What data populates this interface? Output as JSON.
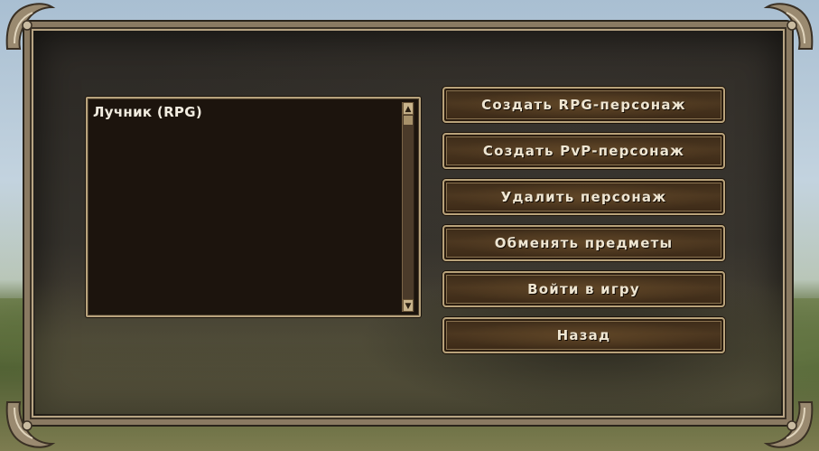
{
  "character_list": {
    "items": [
      {
        "label": "Лучник (RPG)"
      }
    ]
  },
  "menu": {
    "create_rpg_label": "Создать RPG-персонаж",
    "create_pvp_label": "Создать PvP-персонаж",
    "delete_label": "Удалить персонаж",
    "exchange_label": "Обменять предметы",
    "enter_game_label": "Войти в игру",
    "back_label": "Назад"
  },
  "icons": {
    "scroll_up": "arrow-up-icon",
    "scroll_down": "arrow-down-icon",
    "corner": "ornament-corner-icon"
  },
  "colors": {
    "panel": "#2c2925",
    "frame": "#b8a27a",
    "button": "#4c3720",
    "text": "#efe6d2"
  }
}
